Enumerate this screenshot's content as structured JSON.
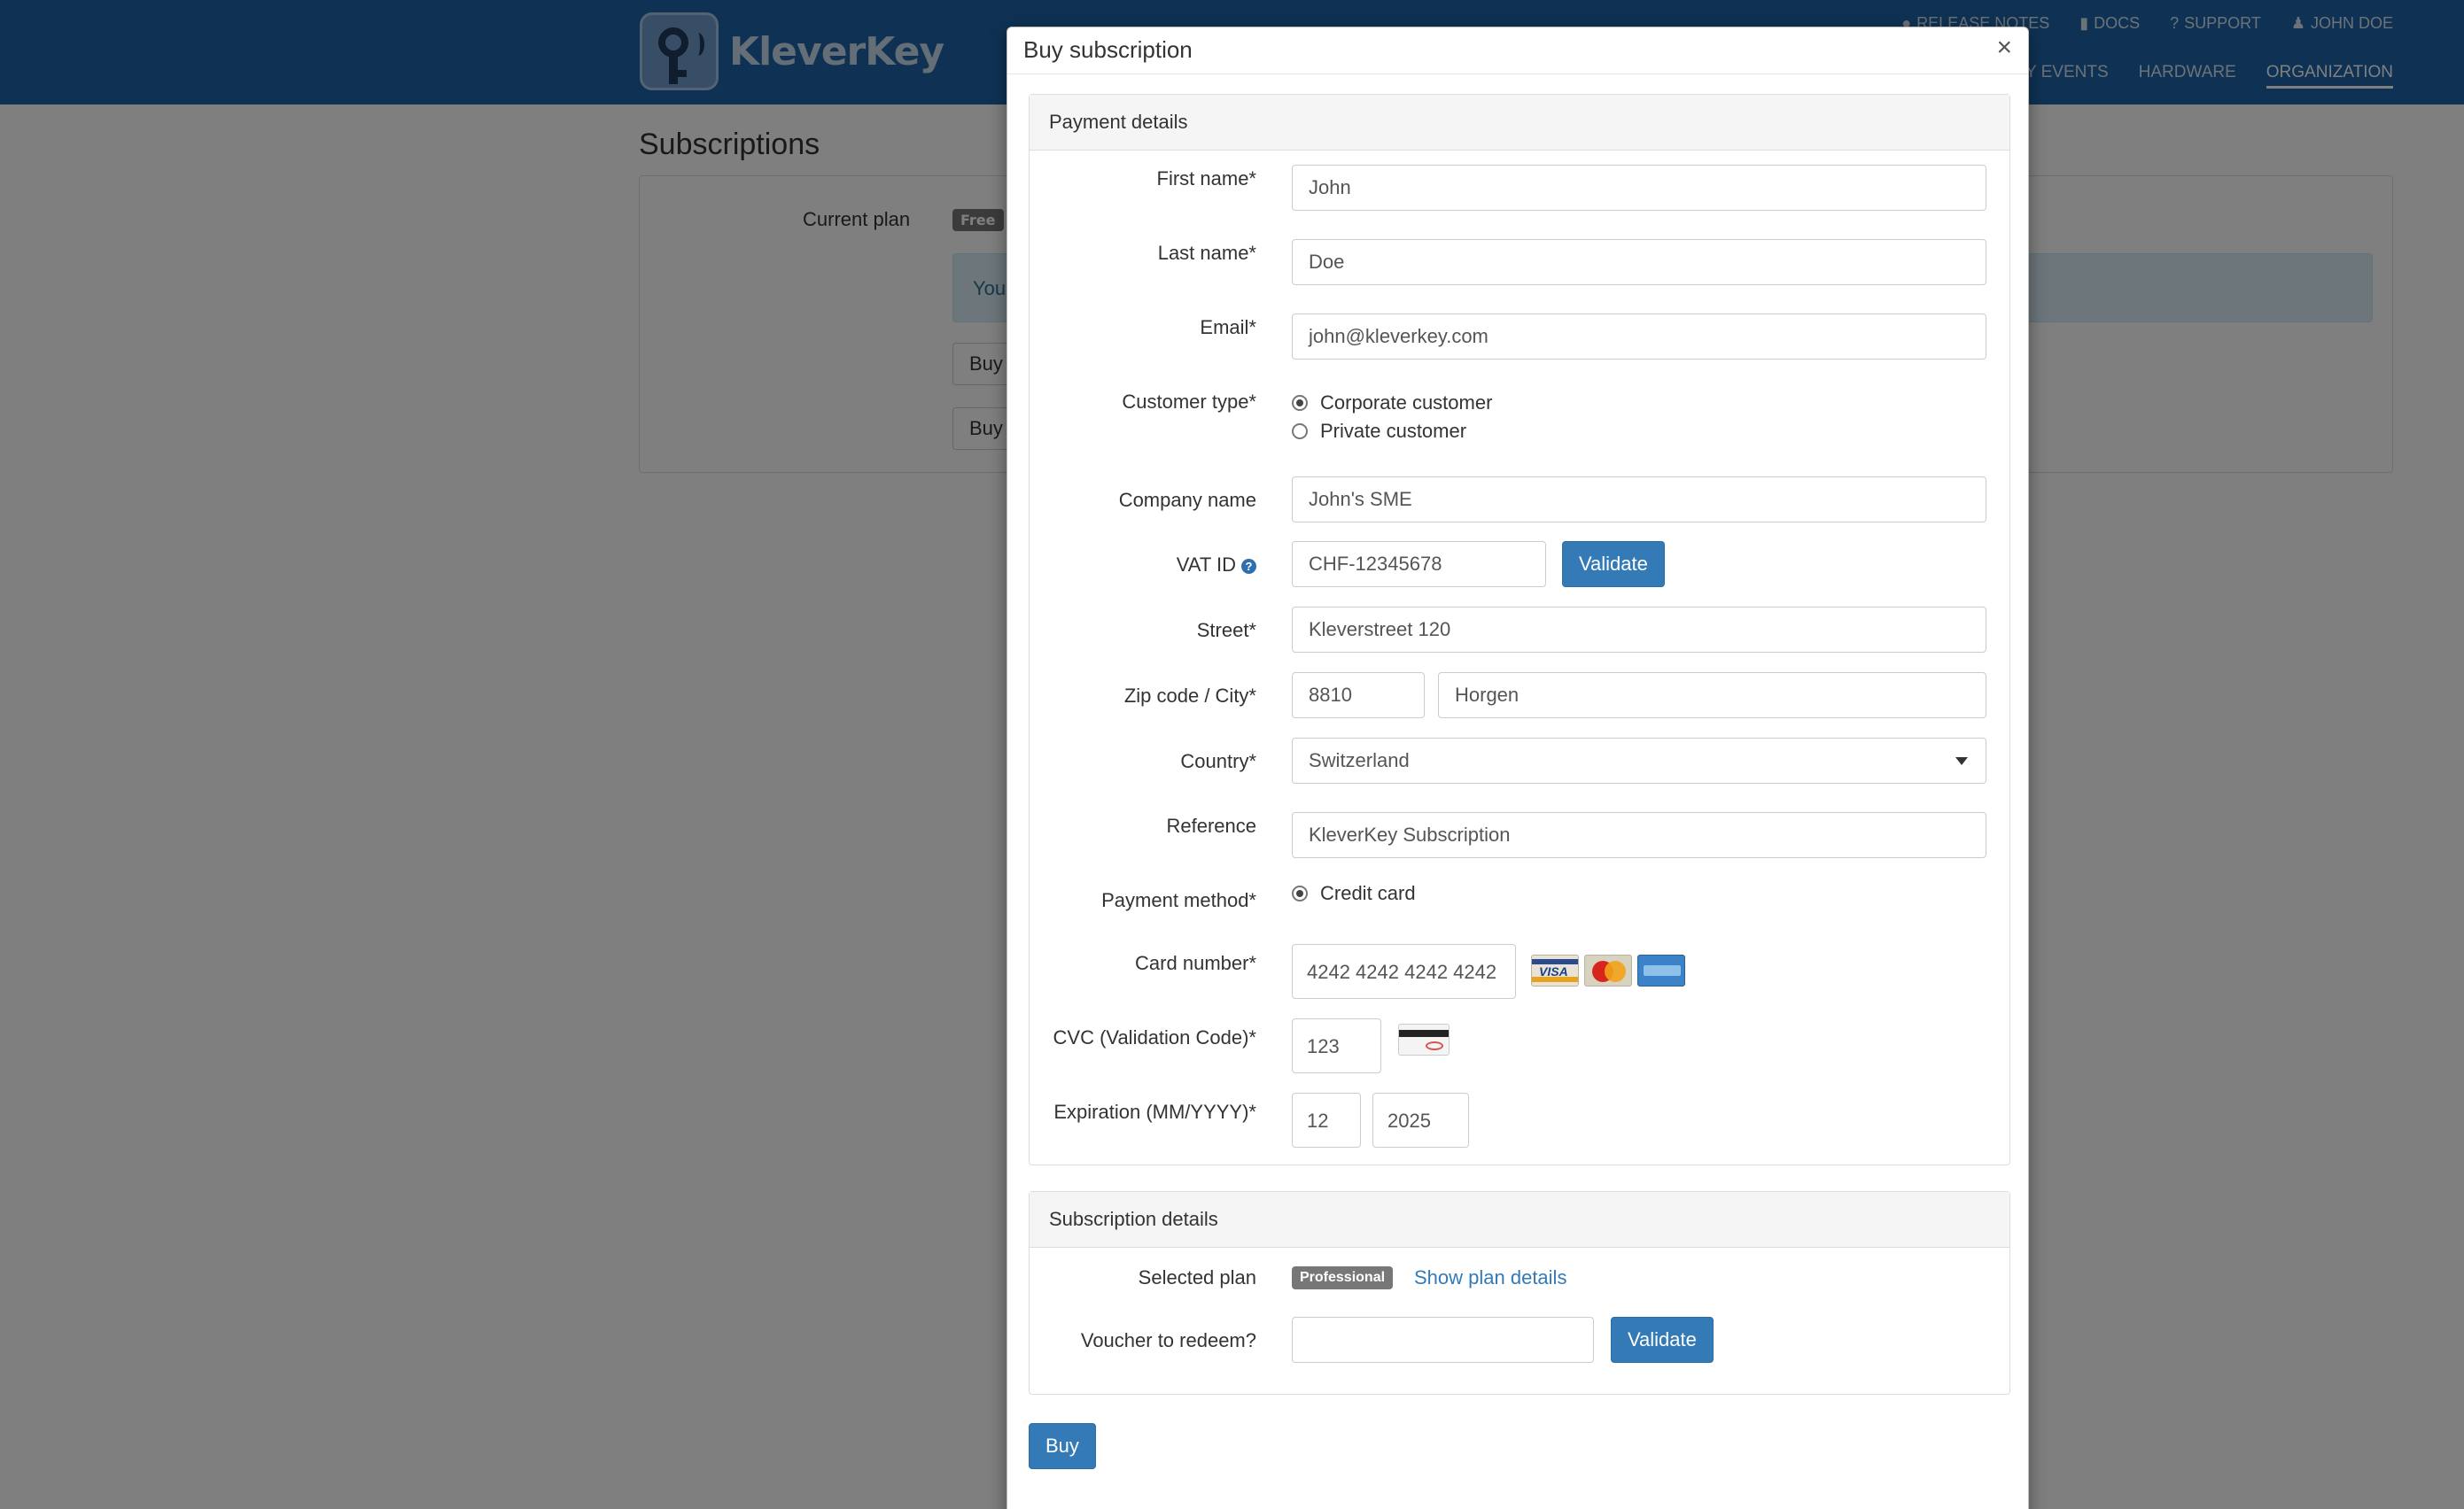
{
  "app": {
    "brand": "KleverKey",
    "accent": "#337ab7",
    "navbar_color": "#1e64a8"
  },
  "topnav": {
    "release_notes": "RELEASE NOTES",
    "docs": "DOCS",
    "support": "SUPPORT",
    "user": "JOHN DOE"
  },
  "mainnav": {
    "my_events": "MY EVENTS",
    "hardware": "HARDWARE",
    "organization": "ORGANIZATION"
  },
  "page": {
    "title": "Subscriptions",
    "current_plan_label": "Current plan",
    "current_plan_badge": "Free",
    "info_text": "You",
    "buy_button_1": "Buy",
    "buy_button_2": "Buy"
  },
  "modal": {
    "title": "Buy subscription",
    "close_icon": "close-icon",
    "payment_section": {
      "heading": "Payment details",
      "first_name_label": "First name*",
      "first_name_value": "John",
      "last_name_label": "Last name*",
      "last_name_value": "Doe",
      "email_label": "Email*",
      "email_value": "john@kleverkey.com",
      "customer_type_label": "Customer type*",
      "customer_type_options": [
        "Corporate customer",
        "Private customer"
      ],
      "customer_type_selected": "Corporate customer",
      "company_label": "Company name",
      "company_value": "John's SME",
      "vat_label": "VAT ID",
      "vat_value": "CHF-12345678",
      "vat_validate": "Validate",
      "street_label": "Street*",
      "street_value": "Kleverstreet 120",
      "zip_city_label": "Zip code / City*",
      "zip_value": "8810",
      "city_value": "Horgen",
      "country_label": "Country*",
      "country_value": "Switzerland",
      "reference_label": "Reference",
      "reference_value": "KleverKey Subscription",
      "payment_method_label": "Payment method*",
      "payment_method_option": "Credit card",
      "card_number_label": "Card number*",
      "card_number_value": "4242 4242 4242 4242",
      "card_brands": [
        "visa-icon",
        "mastercard-icon",
        "amex-icon"
      ],
      "cvc_label": "CVC (Validation Code)*",
      "cvc_value": "123",
      "expiration_label": "Expiration (MM/YYYY)*",
      "exp_month_value": "12",
      "exp_year_value": "2025"
    },
    "subscription_section": {
      "heading": "Subscription details",
      "selected_plan_label": "Selected plan",
      "selected_plan_badge": "Professional",
      "show_plan_details": "Show plan details",
      "voucher_label": "Voucher to redeem?",
      "voucher_value": "",
      "voucher_validate": "Validate"
    },
    "buy_button": "Buy"
  }
}
